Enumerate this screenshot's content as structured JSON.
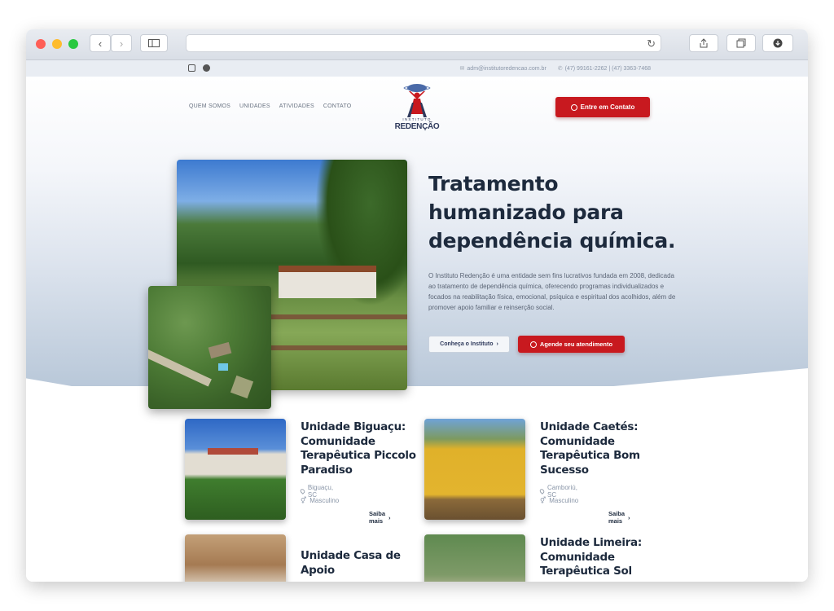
{
  "browser": {
    "back_glyph": "‹",
    "forward_glyph": "›",
    "reload_glyph": "↻"
  },
  "topbar": {
    "email": "adm@institutoredencao.com.br",
    "phone": "(47) 99161-2262 | (47) 3363-7468"
  },
  "nav": {
    "items": [
      "QUEM SOMOS",
      "UNIDADES",
      "ATIVIDADES",
      "CONTATO"
    ]
  },
  "logo": {
    "small": "INSTITUTO",
    "name": "REDENÇÃO"
  },
  "header": {
    "cta": "Entre em Contato"
  },
  "hero": {
    "title": "Tratamento humanizado para dependência química.",
    "description": "O Instituto Redenção é uma entidade sem fins lucrativos fundada em 2008, dedicada ao tratamento de dependência química, oferecendo programas individualizados e focados na reabilitação física, emocional, psíquica e espiritual dos acolhidos, além de promover apoio familiar e reinserção social.",
    "btn_secondary": "Conheça o Instituto",
    "btn_primary": "Agende seu atendimento"
  },
  "units": [
    {
      "title": "Unidade Biguaçu: Comunidade Terapêutica Piccolo Paradiso",
      "location": "Biguaçu, SC",
      "gender": "Masculino",
      "link": "Saiba mais"
    },
    {
      "title": "Unidade Caetés: Comunidade Terapêutica Bom Sucesso",
      "location": "Camboriú, SC",
      "gender": "Masculino",
      "link": "Saiba mais"
    },
    {
      "title": "Unidade Casa de Apoio"
    },
    {
      "title": "Unidade Limeira: Comunidade Terapêutica Sol"
    }
  ],
  "colors": {
    "brand_red": "#c8191f",
    "brand_navy": "#1d2a3d"
  }
}
